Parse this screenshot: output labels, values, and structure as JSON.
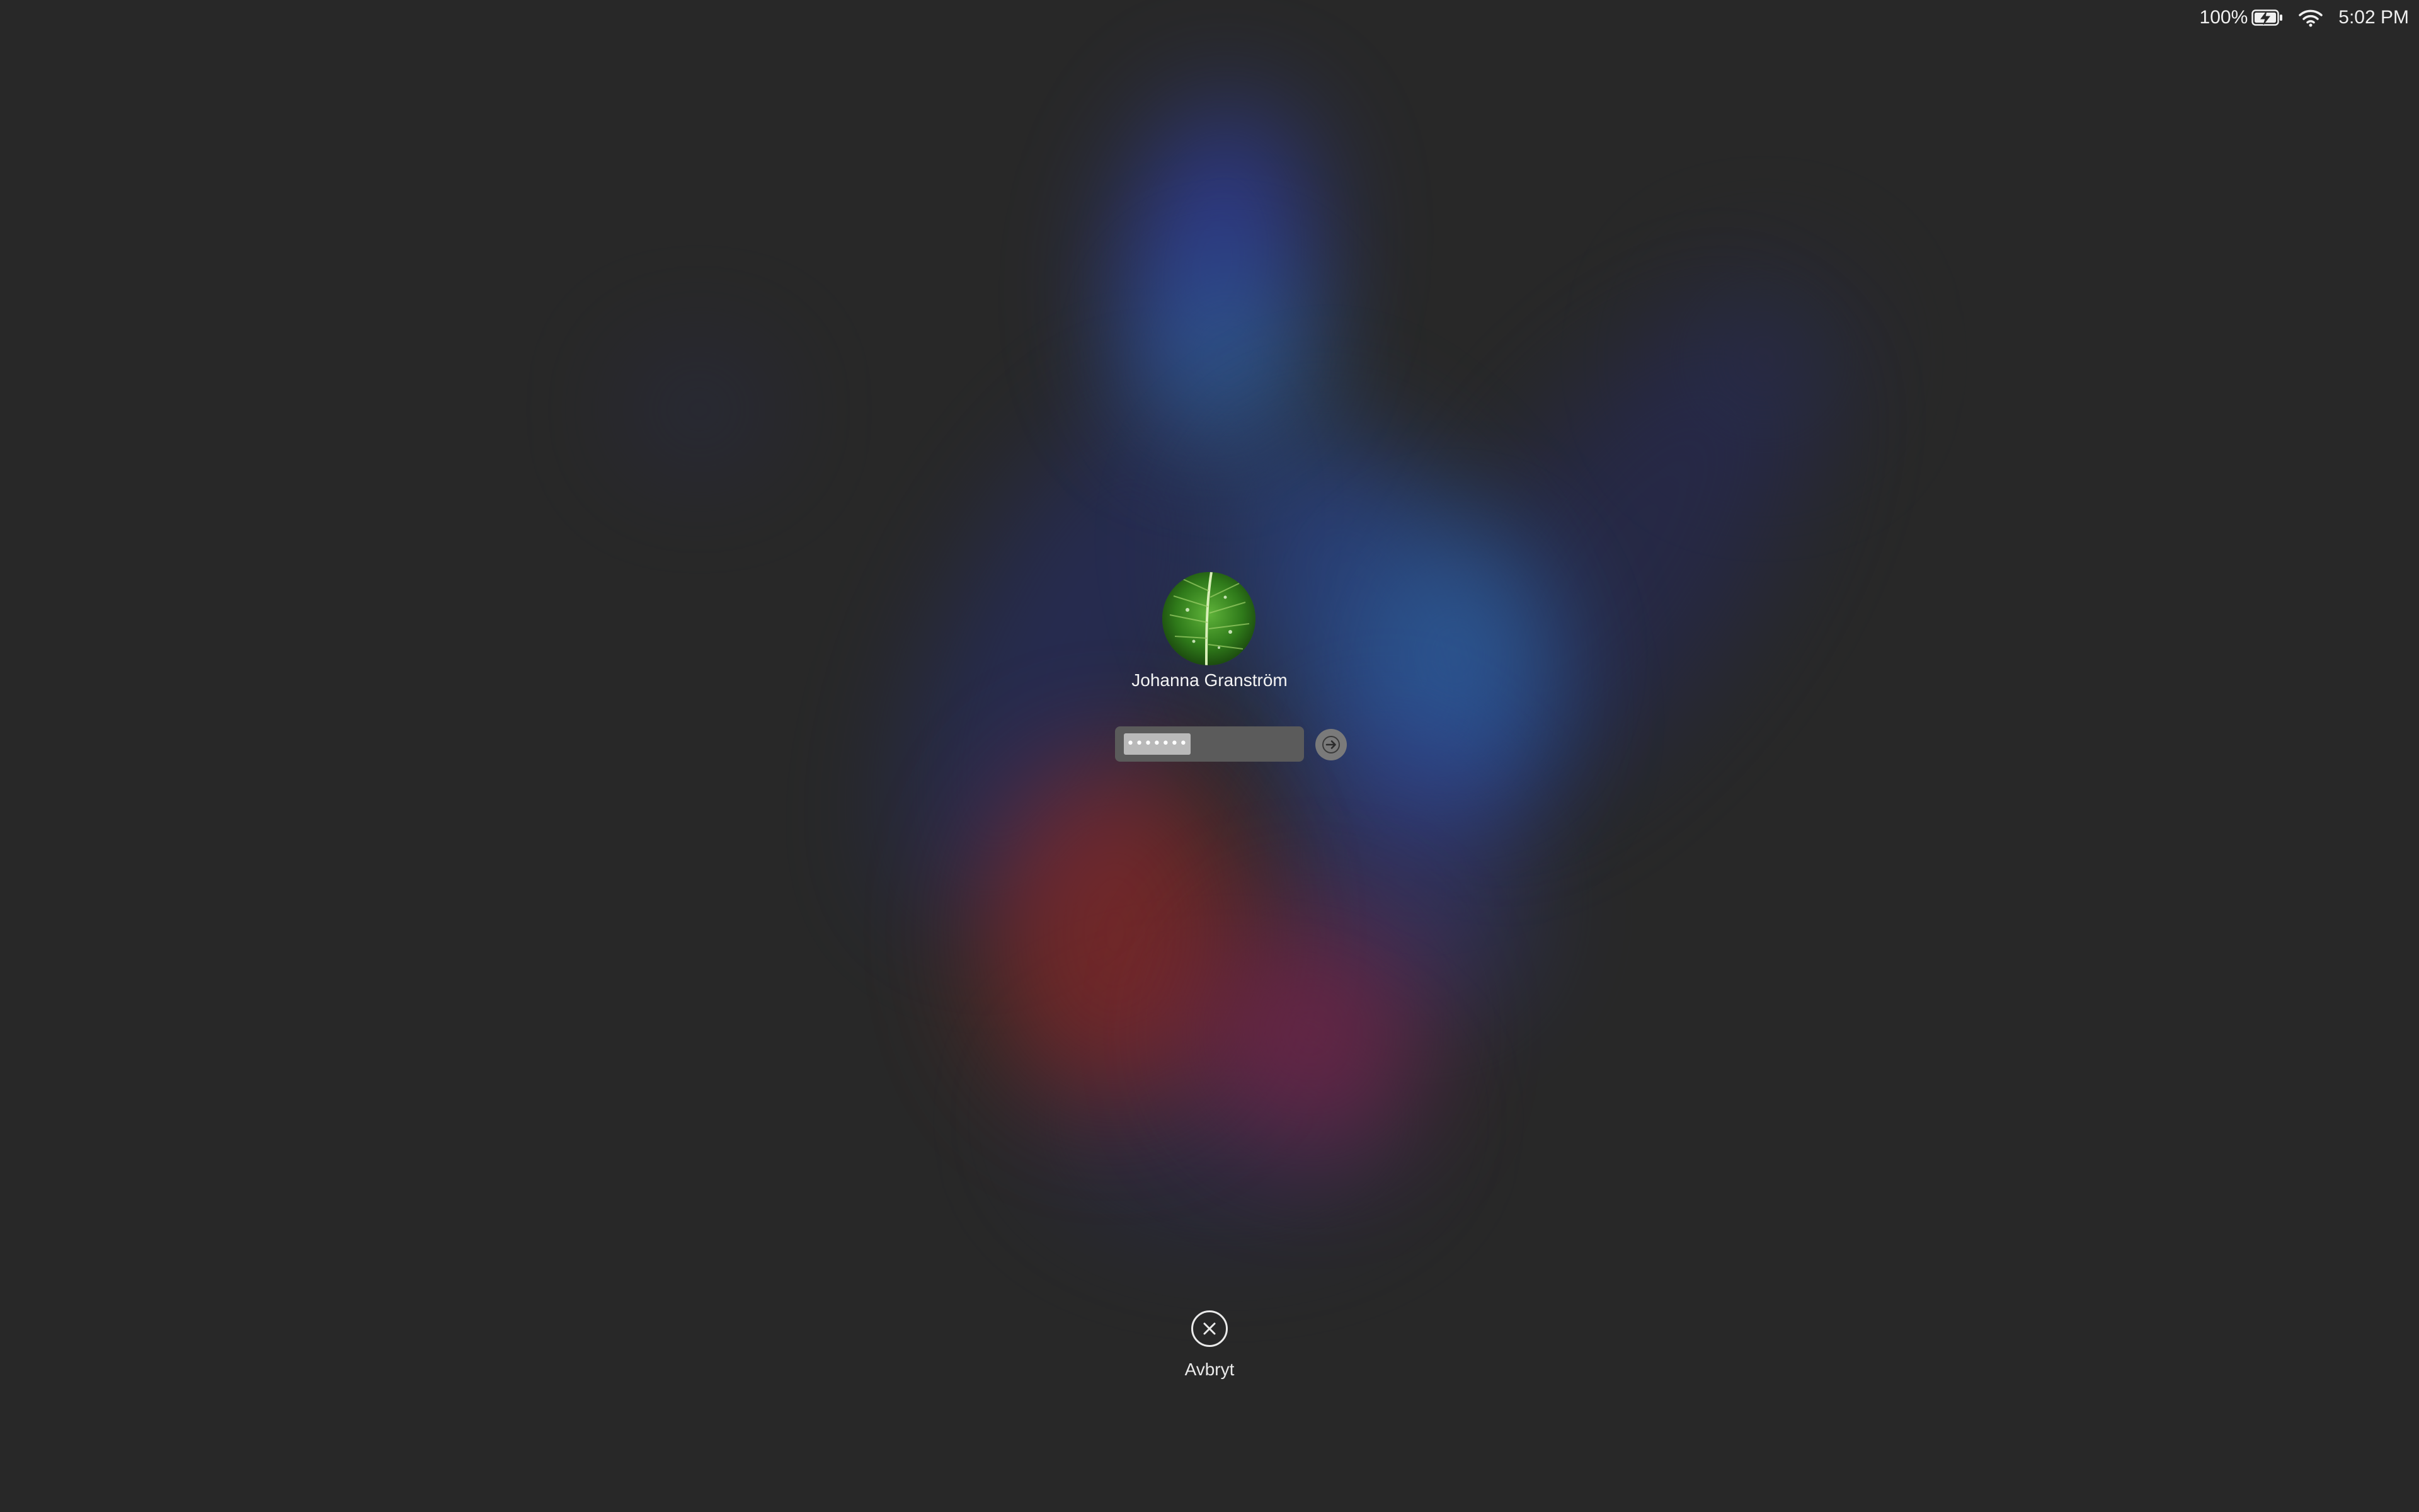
{
  "status_bar": {
    "battery_percent": "100%",
    "battery_icon": "battery-charging-icon",
    "wifi_icon": "wifi-icon",
    "time": "5:02 PM"
  },
  "login": {
    "avatar_icon": "leaf-avatar",
    "user_name": "Johanna Granström",
    "password_value": "•••••••",
    "submit_icon": "arrow-right-icon"
  },
  "cancel": {
    "icon": "close-circle-icon",
    "label": "Avbryt"
  },
  "colors": {
    "background": "#282828",
    "field": "#5b5b5b",
    "submit": "#7a7a7a"
  }
}
